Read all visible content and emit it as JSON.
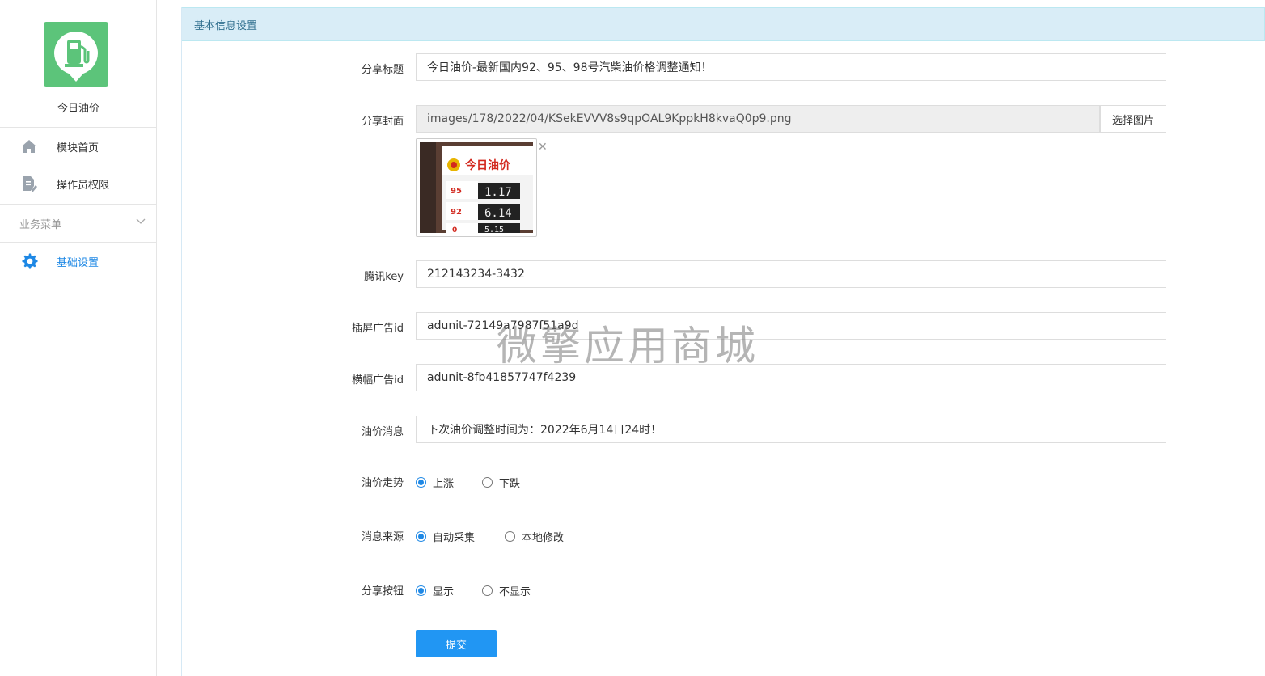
{
  "app": {
    "name": "今日油价",
    "logo_color": "#5cc47a"
  },
  "sidebar": {
    "items": [
      {
        "label": "模块首页",
        "icon": "home-icon"
      },
      {
        "label": "操作员权限",
        "icon": "document-edit-icon"
      }
    ],
    "group": {
      "label": "业务菜单",
      "icon": "chevron-down-icon"
    },
    "group_items": [
      {
        "label": "基础设置",
        "icon": "gear-icon",
        "active": true
      }
    ]
  },
  "panel": {
    "title": "基本信息设置"
  },
  "form": {
    "share_title": {
      "label": "分享标题",
      "value": "今日油价-最新国内92、95、98号汽柴油价格调整通知！"
    },
    "share_cover": {
      "label": "分享封面",
      "value": "images/178/2022/04/KSekEVVV8s9qpOAL9KppkH8kvaQ0p9.png",
      "button": "选择图片",
      "thumb_title": "今日油价",
      "thumb_lines": [
        {
          "grade": "95",
          "price": "1.17"
        },
        {
          "grade": "92",
          "price": "6.14"
        },
        {
          "grade": "0",
          "price": "5.15"
        }
      ]
    },
    "tencent_key": {
      "label": "腾讯key",
      "value": "212143234-3432"
    },
    "interstitial_ad": {
      "label": "插屏广告id",
      "value": "adunit-72149a7987f51a9d"
    },
    "banner_ad": {
      "label": "横幅广告id",
      "value": "adunit-8fb41857747f4239"
    },
    "price_message": {
      "label": "油价消息",
      "value": "下次油价调整时间为：2022年6月14日24时！"
    },
    "trend": {
      "label": "油价走势",
      "options": [
        "上涨",
        "下跌"
      ],
      "selected": 0
    },
    "source": {
      "label": "消息来源",
      "options": [
        "自动采集",
        "本地修改"
      ],
      "selected": 0
    },
    "share_button": {
      "label": "分享按钮",
      "options": [
        "显示",
        "不显示"
      ],
      "selected": 0
    },
    "submit": "提交"
  },
  "watermark": "微擎应用商城",
  "colors": {
    "accent": "#2196f3",
    "panel_header": "#d9edf7",
    "panel_title": "#31708f"
  }
}
